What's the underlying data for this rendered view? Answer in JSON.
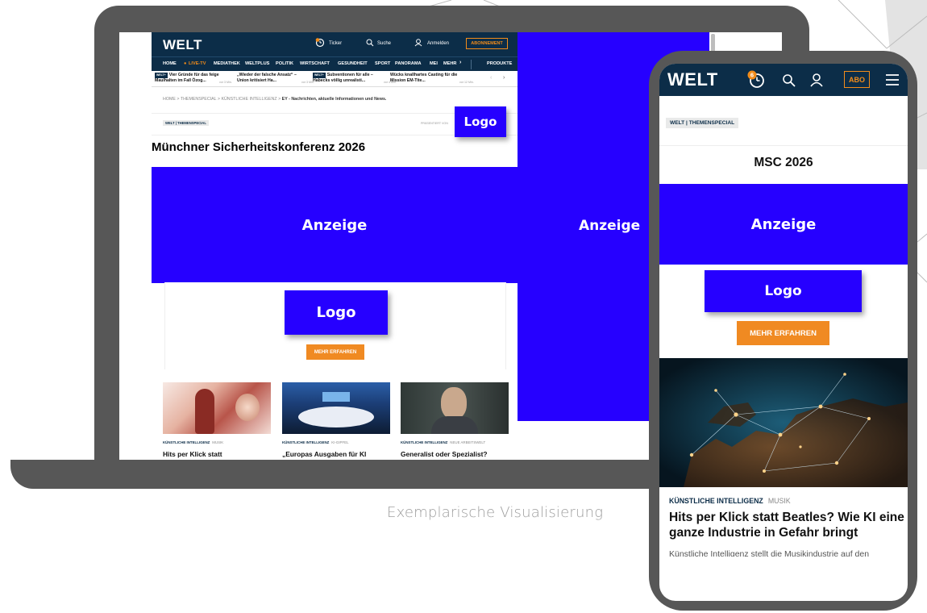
{
  "caption": "Exemplarische Visualisierung",
  "colors": {
    "ad_blue": "#2600ff",
    "welt_navy": "#0c2d48",
    "cta_orange": "#f08a22",
    "device_gray": "#575757"
  },
  "desktop": {
    "logo": "WELT",
    "header": {
      "ticker_label": "Ticker",
      "search_label": "Suche",
      "login_label": "Anmelden",
      "subscribe_label": "ABONNEMENT"
    },
    "nav": [
      "HOME",
      "LIVE-TV",
      "MEDIATHEK",
      "WELTPLUS",
      "POLITIK",
      "WIRTSCHAFT",
      "GESUNDHEIT",
      "SPORT",
      "PANORAMA",
      "MEI",
      "MEHR",
      "PRODUKTE"
    ],
    "ticker": [
      {
        "badge": "WELT+",
        "text": "Vier Gründe für das feige Maulhalten im Fall Özog...",
        "meta": "vor 3 Min."
      },
      {
        "badge": "",
        "text": "„Wieder der falsche Ansatz“ – Union kritisiert Ha...",
        "meta": "vor 3 Min."
      },
      {
        "badge": "WELT+",
        "text": "Subventionen für alle – Habecks völlig unrealisti...",
        "meta": "vor 4 Min."
      },
      {
        "badge": "",
        "text": "Wücks knallhartes Casting für die Mission EM-Tite...",
        "meta": "vor 12 Min."
      }
    ],
    "breadcrumb": {
      "home": "HOME",
      "section": "THEMENSPECIAL",
      "topic": "KÜNSTLICHE INTELLIGENZ",
      "current": "EY - Nachrichten, aktuelle Informationen und News."
    },
    "sponsor_chip": "WELT | THEMENSPECIAL",
    "presented_by": "PRÄSENTIERT VON",
    "logo_label": "Logo",
    "title": "Münchner Sicherheitskonferenz 2026",
    "ad_label": "Anzeige",
    "skyscraper_label": "Anzeige",
    "promo_logo_label": "Logo",
    "cta_label": "MEHR ERFAHREN",
    "cards": [
      {
        "category": "KÜNSTLICHE INTELLIGENZ",
        "subcategory": "MUSIK",
        "headline": "Hits per Klick statt"
      },
      {
        "category": "KÜNSTLICHE INTELLIGENZ",
        "subcategory": "KI-GIPFEL",
        "headline": "„Europas Ausgaben für KI"
      },
      {
        "category": "KÜNSTLICHE INTELLIGENZ",
        "subcategory": "NEUE ARBEITSWELT",
        "headline": "Generalist oder Spezialist?"
      }
    ]
  },
  "mobile": {
    "logo": "WELT",
    "notification_count": "6",
    "abo_label": "ABO",
    "sponsor_chip": "WELT | THEMENSPECIAL",
    "logo_label": "Logo",
    "title": "MSC 2026",
    "ad_label": "Anzeige",
    "promo_logo_label": "Logo",
    "cta_label": "MEHR ERFAHREN",
    "article": {
      "category": "KÜNSTLICHE INTELLIGENZ",
      "subcategory": "MUSIK",
      "headline": "Hits per Klick statt Beatles? Wie KI eine ganze Industrie in Gefahr bringt",
      "teaser": "Künstliche Intelligenz stellt die Musikindustrie auf den"
    }
  }
}
